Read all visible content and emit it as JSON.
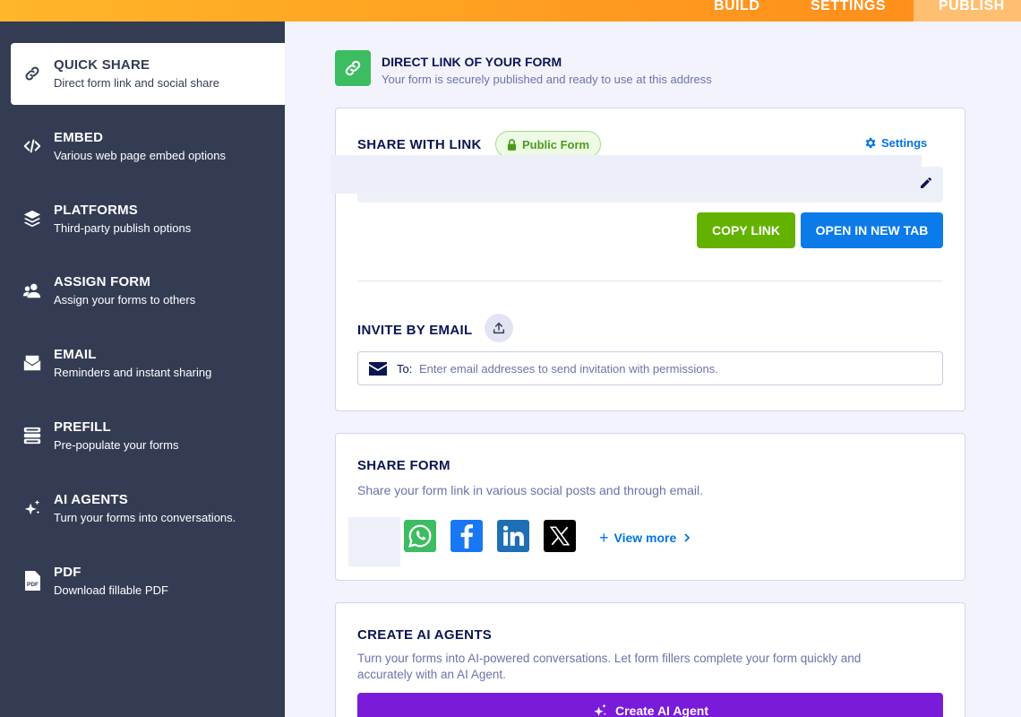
{
  "top_nav": {
    "tabs": [
      {
        "label": "BUILD"
      },
      {
        "label": "SETTINGS"
      },
      {
        "label": "PUBLISH",
        "active": true
      }
    ]
  },
  "sidebar": {
    "items": [
      {
        "title": "QUICK SHARE",
        "subtitle": "Direct form link and social share",
        "icon": "link-icon",
        "active": true
      },
      {
        "title": "EMBED",
        "subtitle": "Various web page embed options",
        "icon": "code-icon"
      },
      {
        "title": "PLATFORMS",
        "subtitle": "Third-party publish options",
        "icon": "layers-icon"
      },
      {
        "title": "ASSIGN FORM",
        "subtitle": "Assign your forms to others",
        "icon": "users-icon"
      },
      {
        "title": "EMAIL",
        "subtitle": "Reminders and instant sharing",
        "icon": "mail-icon"
      },
      {
        "title": "PREFILL",
        "subtitle": "Pre-populate your forms",
        "icon": "prefill-icon"
      },
      {
        "title": "AI AGENTS",
        "subtitle": "Turn your forms into conversations.",
        "icon": "sparkle-icon"
      },
      {
        "title": "PDF",
        "subtitle": "Download fillable PDF",
        "icon": "pdf-icon"
      }
    ]
  },
  "header": {
    "title": "DIRECT LINK OF YOUR FORM",
    "subtitle": "Your form is securely published and ready to use at this address"
  },
  "share_link": {
    "title": "SHARE WITH LINK",
    "badge": "Public Form",
    "settings_label": "Settings",
    "copy_label": "COPY LINK",
    "open_label": "OPEN IN NEW TAB"
  },
  "invite": {
    "title": "INVITE BY EMAIL",
    "to_label": "To:",
    "placeholder": "Enter email addresses to send invitation with permissions."
  },
  "share_form": {
    "title": "SHARE FORM",
    "description": "Share your form link in various social posts and through email.",
    "view_more": "View more",
    "networks": [
      "whatsapp-icon",
      "facebook-icon",
      "linkedin-icon",
      "x-icon"
    ]
  },
  "ai_agents": {
    "title": "CREATE AI AGENTS",
    "description_line1": "Turn your forms into AI-powered conversations. Let form fillers complete your form quickly and",
    "description_line2": "accurately with an AI Agent.",
    "button_label": "Create AI Agent"
  },
  "colors": {
    "accent_orange": "#ff9a1f",
    "sidebar_bg": "#343c54",
    "copy_green": "#64b200",
    "open_blue": "#0a7be8",
    "ai_purple": "#7a1bd9"
  }
}
